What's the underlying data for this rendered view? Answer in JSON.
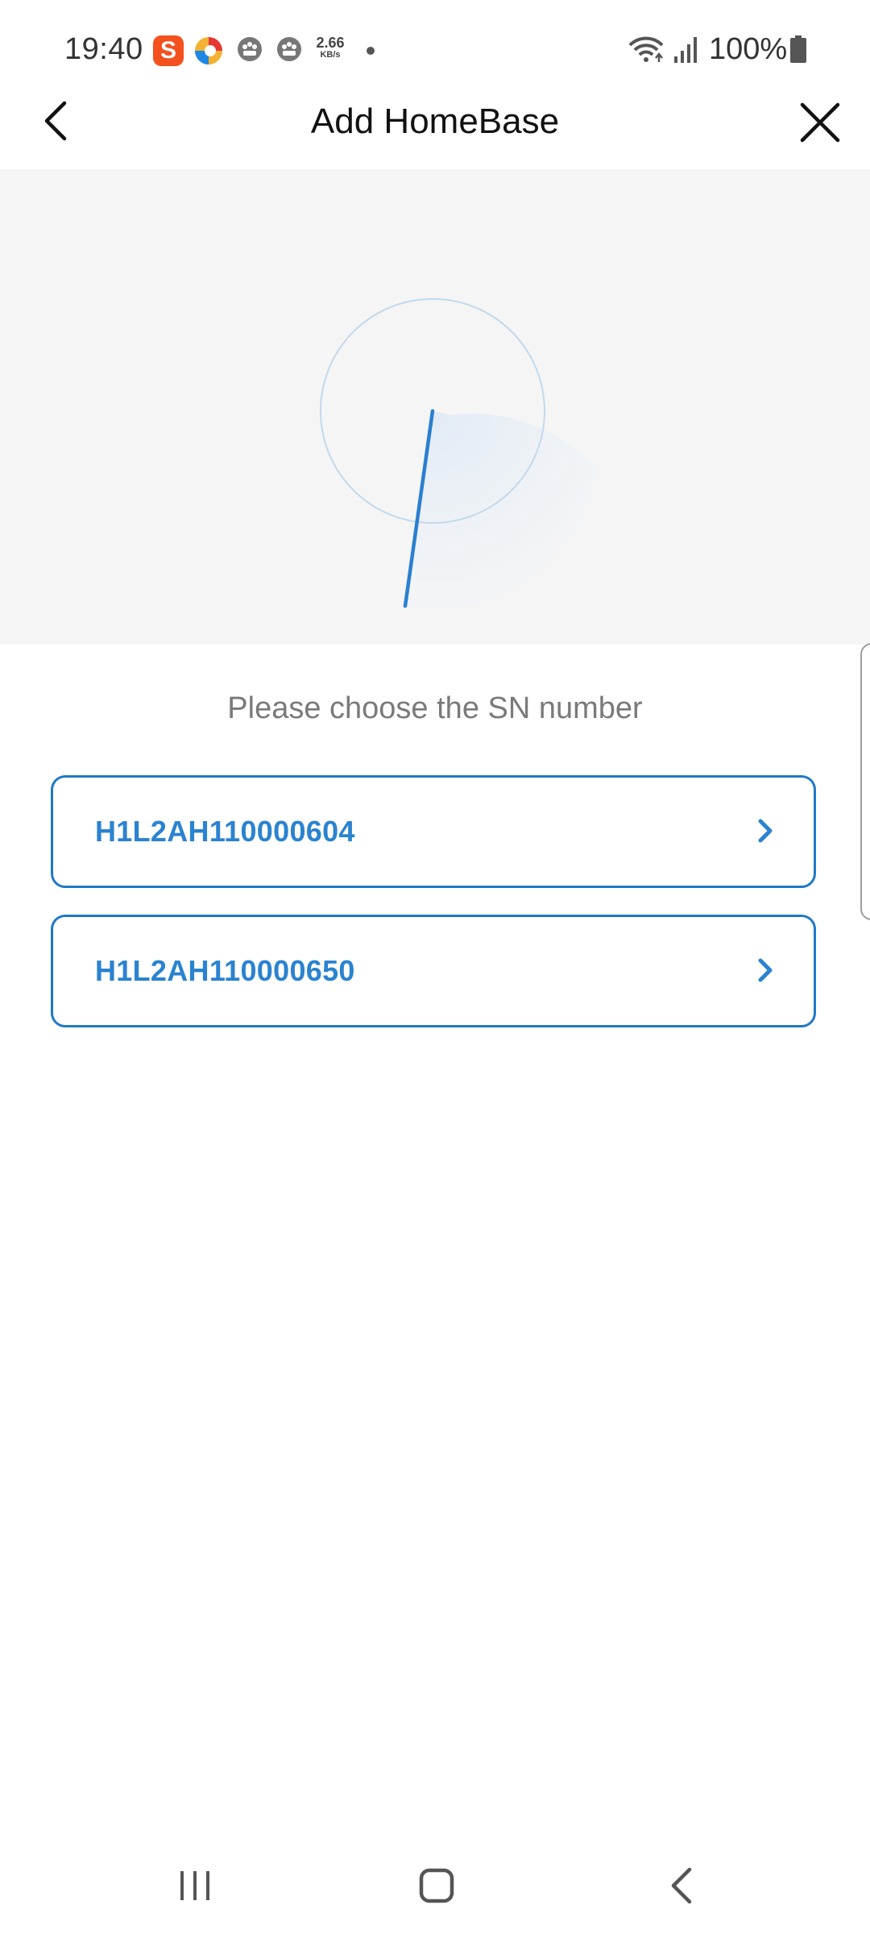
{
  "status_bar": {
    "time": "19:40",
    "net_speed_value": "2.66",
    "net_speed_unit": "KB/s",
    "battery": "100%",
    "icons": [
      "s-app-icon",
      "color-app-icon",
      "gallery-icon",
      "gallery-icon",
      "wifi-icon",
      "signal-icon",
      "battery-icon"
    ]
  },
  "header": {
    "title": "Add HomeBase",
    "back_icon": "chevron-left-icon",
    "close_icon": "close-icon"
  },
  "main": {
    "instruction": "Please choose the SN number",
    "sn_list": [
      {
        "label": "H1L2AH110000604"
      },
      {
        "label": "H1L2AH110000650"
      }
    ]
  },
  "nav_bar": {
    "icons": [
      "recents-icon",
      "home-icon",
      "back-icon"
    ]
  },
  "colors": {
    "accent": "#2b83d0",
    "border": "#1f79c7",
    "illustration_bg": "#f5f5f5",
    "muted_text": "#7a7a7a"
  }
}
